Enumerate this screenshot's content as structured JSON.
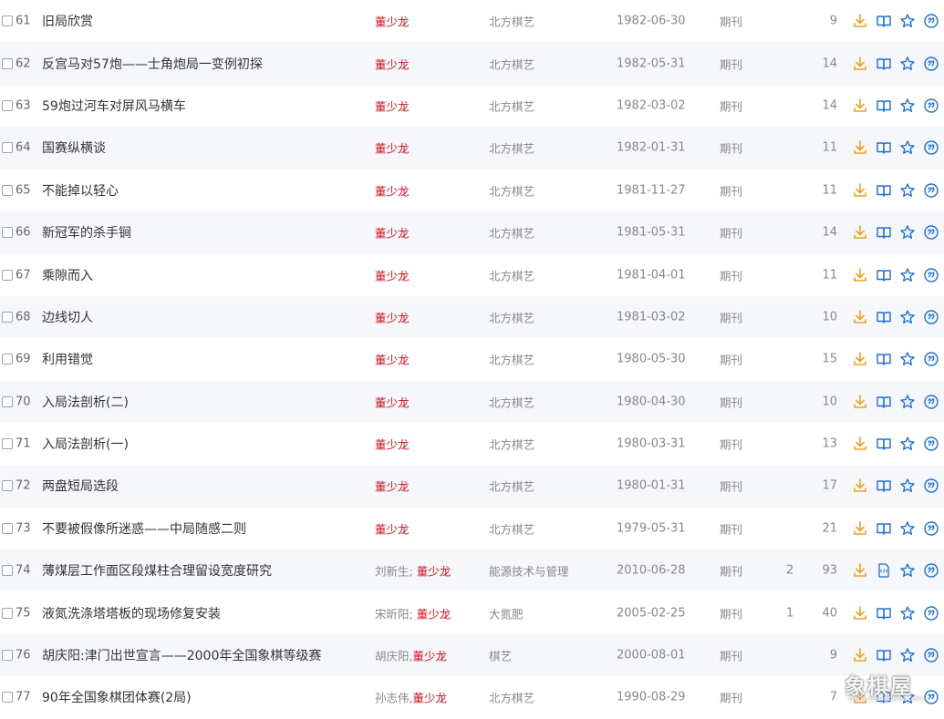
{
  "colors": {
    "author_highlight": "#d0111b",
    "icon_orange": "#f0a020",
    "icon_blue": "#1e6fd9",
    "row_alt": "#f5f7fa"
  },
  "icons": {
    "download": "download-icon",
    "read": "open-book-icon",
    "html_read": "html-doc-icon",
    "favorite": "star-icon",
    "cite": "quote-icon"
  },
  "rows": [
    {
      "num": "61",
      "title": "旧局欣赏",
      "authors": [
        {
          "name": "董少龙",
          "hl": true
        }
      ],
      "source": "北方棋艺",
      "date": "1982-06-30",
      "db": "期刊",
      "cited": "",
      "downloads": "9",
      "read_icon": "book"
    },
    {
      "num": "62",
      "title": "反宫马对57炮——士角炮局一变例初探",
      "authors": [
        {
          "name": "董少龙",
          "hl": true
        }
      ],
      "source": "北方棋艺",
      "date": "1982-05-31",
      "db": "期刊",
      "cited": "",
      "downloads": "14",
      "read_icon": "book"
    },
    {
      "num": "63",
      "title": "59炮过河车对屏风马横车",
      "authors": [
        {
          "name": "董少龙",
          "hl": true
        }
      ],
      "source": "北方棋艺",
      "date": "1982-03-02",
      "db": "期刊",
      "cited": "",
      "downloads": "14",
      "read_icon": "book"
    },
    {
      "num": "64",
      "title": "国赛纵横谈",
      "authors": [
        {
          "name": "董少龙",
          "hl": true
        }
      ],
      "source": "北方棋艺",
      "date": "1982-01-31",
      "db": "期刊",
      "cited": "",
      "downloads": "11",
      "read_icon": "book"
    },
    {
      "num": "65",
      "title": "不能掉以轻心",
      "authors": [
        {
          "name": "董少龙",
          "hl": true
        }
      ],
      "source": "北方棋艺",
      "date": "1981-11-27",
      "db": "期刊",
      "cited": "",
      "downloads": "11",
      "read_icon": "book"
    },
    {
      "num": "66",
      "title": "新冠军的杀手锏",
      "authors": [
        {
          "name": "董少龙",
          "hl": true
        }
      ],
      "source": "北方棋艺",
      "date": "1981-05-31",
      "db": "期刊",
      "cited": "",
      "downloads": "14",
      "read_icon": "book"
    },
    {
      "num": "67",
      "title": "乘隙而入",
      "authors": [
        {
          "name": "董少龙",
          "hl": true
        }
      ],
      "source": "北方棋艺",
      "date": "1981-04-01",
      "db": "期刊",
      "cited": "",
      "downloads": "11",
      "read_icon": "book"
    },
    {
      "num": "68",
      "title": "边线切人",
      "authors": [
        {
          "name": "董少龙",
          "hl": true
        }
      ],
      "source": "北方棋艺",
      "date": "1981-03-02",
      "db": "期刊",
      "cited": "",
      "downloads": "10",
      "read_icon": "book"
    },
    {
      "num": "69",
      "title": "利用错觉",
      "authors": [
        {
          "name": "董少龙",
          "hl": true
        }
      ],
      "source": "北方棋艺",
      "date": "1980-05-30",
      "db": "期刊",
      "cited": "",
      "downloads": "15",
      "read_icon": "book"
    },
    {
      "num": "70",
      "title": "入局法剖析(二)",
      "authors": [
        {
          "name": "董少龙",
          "hl": true
        }
      ],
      "source": "北方棋艺",
      "date": "1980-04-30",
      "db": "期刊",
      "cited": "",
      "downloads": "10",
      "read_icon": "book"
    },
    {
      "num": "71",
      "title": "入局法剖析(一)",
      "authors": [
        {
          "name": "董少龙",
          "hl": true
        }
      ],
      "source": "北方棋艺",
      "date": "1980-03-31",
      "db": "期刊",
      "cited": "",
      "downloads": "13",
      "read_icon": "book"
    },
    {
      "num": "72",
      "title": "两盘短局选段",
      "authors": [
        {
          "name": "董少龙",
          "hl": true
        }
      ],
      "source": "北方棋艺",
      "date": "1980-01-31",
      "db": "期刊",
      "cited": "",
      "downloads": "17",
      "read_icon": "book"
    },
    {
      "num": "73",
      "title": "不要被假像所迷惑——中局随感二则",
      "authors": [
        {
          "name": "董少龙",
          "hl": true
        }
      ],
      "source": "北方棋艺",
      "date": "1979-05-31",
      "db": "期刊",
      "cited": "",
      "downloads": "21",
      "read_icon": "book"
    },
    {
      "num": "74",
      "title": "薄煤层工作面区段煤柱合理留设宽度研究",
      "authors": [
        {
          "name": "刘新生; ",
          "hl": false
        },
        {
          "name": "董少龙",
          "hl": true
        }
      ],
      "source": "能源技术与管理",
      "date": "2010-06-28",
      "db": "期刊",
      "cited": "2",
      "downloads": "93",
      "read_icon": "html"
    },
    {
      "num": "75",
      "title": "液氮洗涤塔塔板的现场修复安装",
      "authors": [
        {
          "name": "宋昕阳; ",
          "hl": false
        },
        {
          "name": "董少龙",
          "hl": true
        }
      ],
      "source": "大氮肥",
      "date": "2005-02-25",
      "db": "期刊",
      "cited": "1",
      "downloads": "40",
      "read_icon": "book"
    },
    {
      "num": "76",
      "title": "胡庆阳:津门出世宣言——2000年全国象棋等级赛",
      "authors": [
        {
          "name": "胡庆阳,",
          "hl": false
        },
        {
          "name": "董少龙",
          "hl": true
        }
      ],
      "source": "棋艺",
      "date": "2000-08-01",
      "db": "期刊",
      "cited": "",
      "downloads": "9",
      "read_icon": "book"
    },
    {
      "num": "77",
      "title": "90年全国象棋团体赛(2局)",
      "authors": [
        {
          "name": "孙志伟,",
          "hl": false
        },
        {
          "name": "董少龙",
          "hl": true
        }
      ],
      "source": "北方棋艺",
      "date": "1990-08-29",
      "db": "期刊",
      "cited": "",
      "downloads": "7",
      "read_icon": "book"
    }
  ],
  "watermark": {
    "text": "象棋屋",
    "url": "www.xiangqiwu.com"
  }
}
